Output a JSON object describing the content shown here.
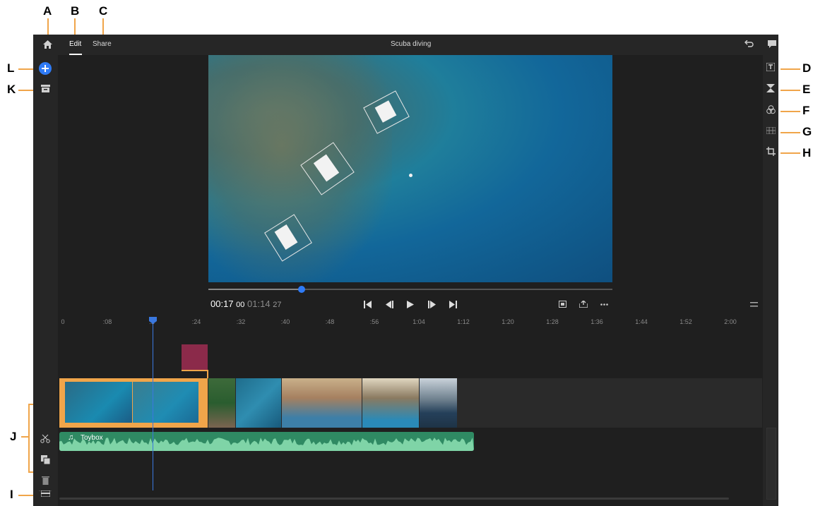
{
  "callouts": {
    "A": "A",
    "B": "B",
    "C": "C",
    "D": "D",
    "E": "E",
    "F": "F",
    "G": "G",
    "H": "H",
    "I": "I",
    "J": "J",
    "K": "K",
    "L": "L"
  },
  "topbar": {
    "edit_label": "Edit",
    "share_label": "Share",
    "project_title": "Scuba diving"
  },
  "player": {
    "current_time": "00:17",
    "current_frames": "00",
    "total_time": "01:14",
    "total_frames": "27",
    "scrub_progress": 0.23
  },
  "ruler": {
    "labels": [
      "0",
      ":08",
      ":1",
      ":24",
      ":32",
      ":40",
      ":48",
      ":56",
      "1:04",
      "1:12",
      "1:20",
      "1:28",
      "1:36",
      "1:44",
      "1:52",
      "2:00"
    ]
  },
  "audio": {
    "track_name": "Toybox"
  },
  "colors": {
    "accent": "#3a78e0",
    "clip_selected": "#f0a54a",
    "title_clip": "#8b2a4a",
    "audio_track": "#2f8a63",
    "callout_line": "#f0a54a"
  },
  "icons": {
    "home": "home-icon",
    "add": "add-media-icon",
    "media": "media-bin-icon",
    "undo": "undo-icon",
    "feedback": "feedback-icon",
    "titles": "titles-icon",
    "transitions": "transitions-icon",
    "color": "color-icon",
    "speed": "speed-icon",
    "crop": "crop-icon",
    "split": "split-icon",
    "duplicate": "duplicate-icon",
    "delete": "delete-icon",
    "track": "track-icon",
    "timeline_view": "timeline-view-icon"
  }
}
